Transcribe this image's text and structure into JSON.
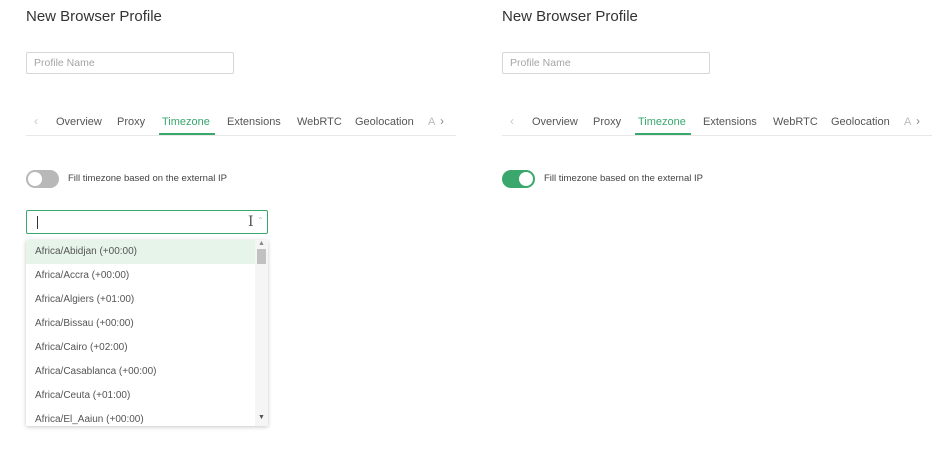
{
  "panels": [
    {
      "title": "New Browser Profile",
      "profile_name": {
        "value": "",
        "placeholder": "Profile Name"
      },
      "tabs": [
        "Overview",
        "Proxy",
        "Timezone",
        "Extensions",
        "WebRTC",
        "Geolocation",
        "A"
      ],
      "active_tab": "Timezone",
      "tab_prev_icon": "chevron-left-icon",
      "tab_next_icon": "chevron-right-icon",
      "toggle": {
        "label": "Fill timezone based on the external IP",
        "on": false
      },
      "timezone_search": {
        "value": ""
      },
      "timezone_options": [
        "Africa/Abidjan (+00:00)",
        "Africa/Accra (+00:00)",
        "Africa/Algiers (+01:00)",
        "Africa/Bissau (+00:00)",
        "Africa/Cairo (+02:00)",
        "Africa/Casablanca (+00:00)",
        "Africa/Ceuta (+01:00)",
        "Africa/El_Aaiun (+00:00)"
      ],
      "highlighted_option": "Africa/Abidjan (+00:00)"
    },
    {
      "title": "New Browser Profile",
      "profile_name": {
        "value": "",
        "placeholder": "Profile Name"
      },
      "tabs": [
        "Overview",
        "Proxy",
        "Timezone",
        "Extensions",
        "WebRTC",
        "Geolocation",
        "A"
      ],
      "active_tab": "Timezone",
      "tab_prev_icon": "chevron-left-icon",
      "tab_next_icon": "chevron-right-icon",
      "toggle": {
        "label": "Fill timezone based on the external IP",
        "on": true
      }
    }
  ],
  "colors": {
    "accent": "#3aa76d",
    "highlight": "#e6f4ea",
    "toggle_off": "#b8b8b8"
  }
}
